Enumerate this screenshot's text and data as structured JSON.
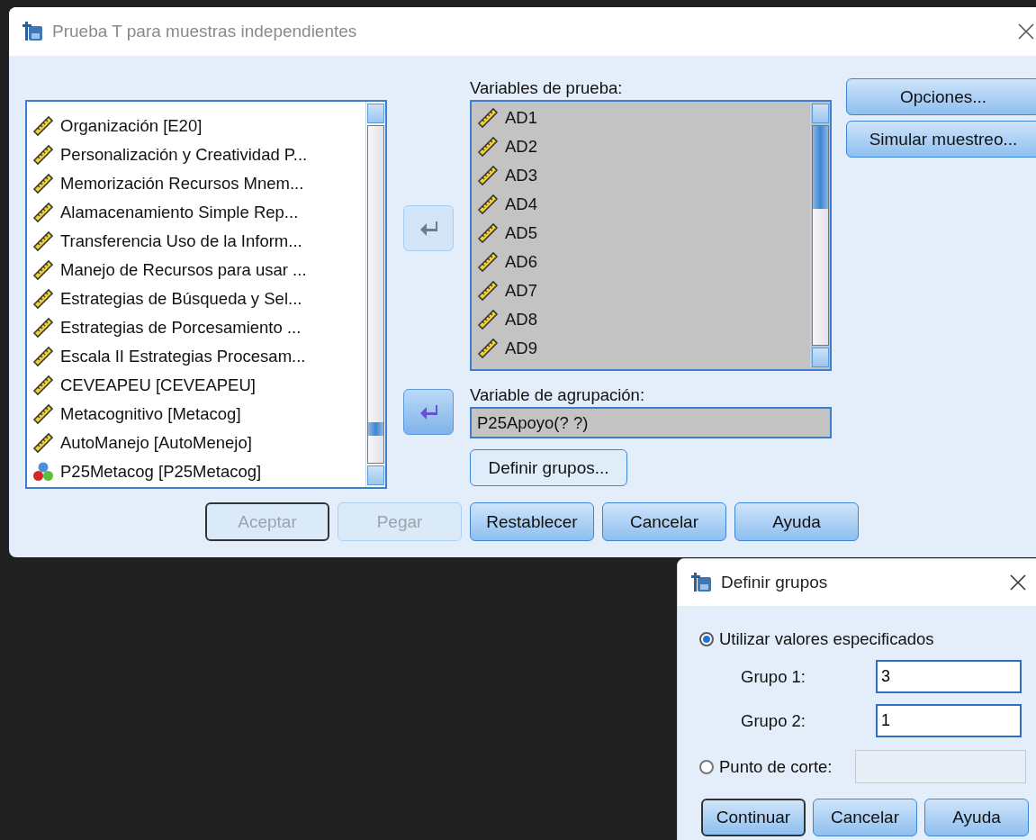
{
  "main_window": {
    "title": "Prueba T para muestras independientes",
    "source_list": {
      "items": [
        {
          "label": "Organización [E20]",
          "kind": "scale"
        },
        {
          "label": "Personalización y Creatividad P...",
          "kind": "scale"
        },
        {
          "label": "Memorización Recursos Mnem...",
          "kind": "scale"
        },
        {
          "label": "Alamacenamiento Simple Rep...",
          "kind": "scale"
        },
        {
          "label": "Transferencia Uso de la Inform...",
          "kind": "scale"
        },
        {
          "label": "Manejo de Recursos para usar ...",
          "kind": "scale"
        },
        {
          "label": "Estrategias de Búsqueda y Sel...",
          "kind": "scale"
        },
        {
          "label": "Estrategias de Porcesamiento ...",
          "kind": "scale"
        },
        {
          "label": "Escala II Estrategias Procesam...",
          "kind": "scale"
        },
        {
          "label": "CEVEAPEU [CEVEAPEU]",
          "kind": "scale"
        },
        {
          "label": "Metacognitivo [Metacog]",
          "kind": "scale"
        },
        {
          "label": "AutoManejo [AutoMenejo]",
          "kind": "scale"
        },
        {
          "label": "P25Metacog [P25Metacog]",
          "kind": "nominal"
        }
      ]
    },
    "move_buttons": [
      {
        "disabled": true
      },
      {
        "disabled": false
      }
    ],
    "test_variables": {
      "label": "Variables de prueba:",
      "items": [
        {
          "label": "AD1",
          "kind": "scale"
        },
        {
          "label": "AD2",
          "kind": "scale"
        },
        {
          "label": "AD3",
          "kind": "scale"
        },
        {
          "label": "AD4",
          "kind": "scale"
        },
        {
          "label": "AD5",
          "kind": "scale"
        },
        {
          "label": "AD6",
          "kind": "scale"
        },
        {
          "label": "AD7",
          "kind": "scale"
        },
        {
          "label": "AD8",
          "kind": "scale"
        },
        {
          "label": "AD9",
          "kind": "scale"
        }
      ]
    },
    "grouping_variable": {
      "label": "Variable de agrupación:",
      "value": "P25Apoyo(? ?)"
    },
    "define_groups_button": "Definir grupos...",
    "side_buttons": [
      {
        "label": "Opciones..."
      },
      {
        "label": "Simular muestreo..."
      }
    ],
    "buttons": [
      {
        "label": "Aceptar",
        "disabled": true,
        "default": true
      },
      {
        "label": "Pegar",
        "disabled": true,
        "default": false
      },
      {
        "label": "Restablecer",
        "disabled": false,
        "default": false
      },
      {
        "label": "Cancelar",
        "disabled": false,
        "default": false
      },
      {
        "label": "Ayuda",
        "disabled": false,
        "default": false
      }
    ]
  },
  "define_groups_window": {
    "title": "Definir grupos",
    "options": [
      {
        "label": "Utilizar valores especificados",
        "selected": true
      },
      {
        "label": "Punto de corte:",
        "selected": false
      }
    ],
    "group_fields": [
      {
        "label": "Grupo 1:",
        "value": "3"
      },
      {
        "label": "Grupo 2:",
        "value": "1"
      }
    ],
    "cutpoint_field": {
      "disabled": true
    },
    "buttons": [
      {
        "label": "Continuar",
        "default": true
      },
      {
        "label": "Cancelar",
        "default": false
      },
      {
        "label": "Ayuda",
        "default": false
      }
    ]
  }
}
